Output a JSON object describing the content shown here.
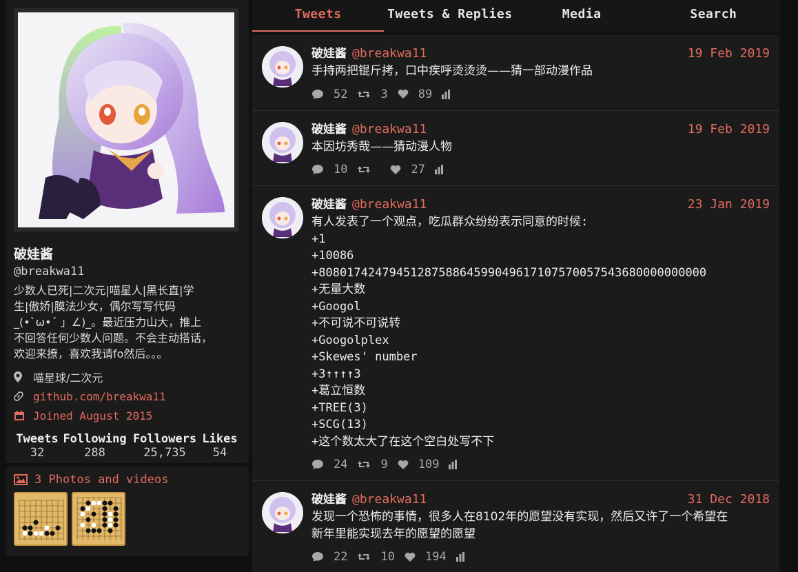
{
  "profile": {
    "fullname": "破娃酱",
    "handle": "@breakwa11",
    "bio": "少数人已死|二次元|喵星人|黑长直|学\n生|傲娇|膜法少女，偶尔写写代码\n_(•`ω•´ 」∠)_。最近压力山大，推上\n不回答任何少数人问题。不会主动搭话，\n欢迎来撩，喜欢我请fo然后。。。",
    "location": "喵星球/二次元",
    "website": "github.com/breakwa11",
    "joined": "Joined August 2015",
    "stats": [
      {
        "label": "Tweets",
        "value": "32"
      },
      {
        "label": "Following",
        "value": "288"
      },
      {
        "label": "Followers",
        "value": "25,735"
      },
      {
        "label": "Likes",
        "value": "54"
      }
    ]
  },
  "photos": {
    "label": "3 Photos and videos"
  },
  "tabs": [
    {
      "label": "Tweets",
      "active": true
    },
    {
      "label": "Tweets & Replies",
      "active": false
    },
    {
      "label": "Media",
      "active": false
    },
    {
      "label": "Search",
      "active": false
    }
  ],
  "tweets": [
    {
      "name": "破娃酱",
      "handle": "@breakwa11",
      "date": "19 Feb 2019",
      "text": "手持两把锟斤拷，口中疾呼烫烫烫——猜一部动漫作品",
      "replies": "52",
      "retweets": "3",
      "likes": "89"
    },
    {
      "name": "破娃酱",
      "handle": "@breakwa11",
      "date": "19 Feb 2019",
      "text": "本因坊秀哉——猜动漫人物",
      "replies": "10",
      "retweets": "",
      "likes": "27"
    },
    {
      "name": "破娃酱",
      "handle": "@breakwa11",
      "date": "23 Jan 2019",
      "text": "有人发表了一个观点，吃瓜群众纷纷表示同意的时候:\n+1\n+10086\n+8080174247945128758864599049617107570057543680000000000\n+无量大数\n+Googol\n+不可说不可说转\n+Googolplex\n+Skewes' number\n+3↑↑↑↑3\n+葛立恒数\n+TREE(3)\n+SCG(13)\n+这个数太大了在这个空白处写不下",
      "replies": "24",
      "retweets": "9",
      "likes": "109"
    },
    {
      "name": "破娃酱",
      "handle": "@breakwa11",
      "date": "31 Dec 2018",
      "text": "发现一个恐怖的事情，很多人在8102年的愿望没有实现，然后又许了一个希望在\n新年里能实现去年的愿望的愿望",
      "replies": "22",
      "retweets": "10",
      "likes": "194"
    }
  ],
  "colors": {
    "accent": "#e26b5d",
    "card_bg": "#1b1b1b",
    "page_bg": "#101010"
  }
}
